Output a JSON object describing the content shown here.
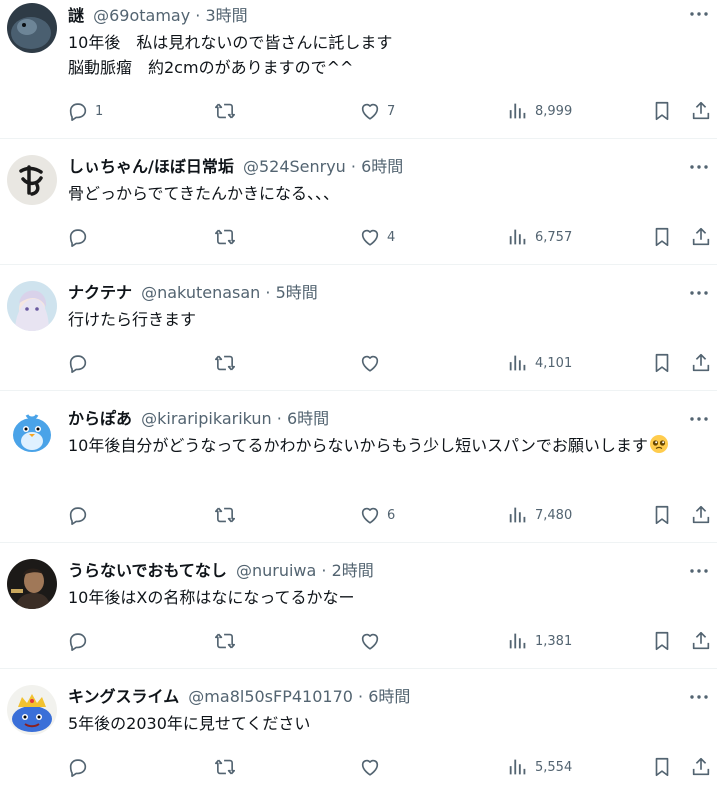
{
  "tweets": [
    {
      "name": "謎",
      "handle": "@69otamay",
      "dot": "·",
      "time": "3時間",
      "text": "10年後　私は見れないので皆さんに託します\n脳動脈瘤　約2cmのがありますので^^",
      "replies": "1",
      "retweets": "",
      "likes": "7",
      "views": "8,999"
    },
    {
      "name": "しぃちゃん/ほぼ日常垢",
      "handle": "@524Senryu",
      "dot": "·",
      "time": "6時間",
      "text": "骨どっからでてきたんかきになる、、、",
      "replies": "",
      "retweets": "",
      "likes": "4",
      "views": "6,757"
    },
    {
      "name": "ナクテナ",
      "handle": "@nakutenasan",
      "dot": "·",
      "time": "5時間",
      "text": "行けたら行きます",
      "replies": "",
      "retweets": "",
      "likes": "",
      "views": "4,101"
    },
    {
      "name": "からぽあ",
      "handle": "@kiraripikarikun",
      "dot": "·",
      "time": "6時間",
      "text": "10年後自分がどうなってるかわからないからもう少し短いスパンでお願いします",
      "replies": "",
      "retweets": "",
      "likes": "6",
      "views": "7,480"
    },
    {
      "name": "うらないでおもてなし",
      "handle": "@nuruiwa",
      "dot": "·",
      "time": "2時間",
      "text": "10年後はXの名称はなになってるかなー",
      "replies": "",
      "retweets": "",
      "likes": "",
      "views": "1,381"
    },
    {
      "name": "キングスライム",
      "handle": "@ma8l50sFP410170",
      "dot": "·",
      "time": "6時間",
      "text": "5年後の2030年に見せてください",
      "replies": "",
      "retweets": "",
      "likes": "",
      "views": "5,554"
    }
  ],
  "icons": {
    "avatars": [
      "dark-creature-avatar",
      "brush-calligraphy-avatar",
      "anime-girl-avatar",
      "blue-bird-avatar",
      "man-portrait-avatar",
      "king-slime-avatar"
    ],
    "emoji": "pleading-face-emoji"
  },
  "colors": {
    "text": "#0f1419",
    "secondary": "#536471",
    "divider": "#eff3f4"
  }
}
